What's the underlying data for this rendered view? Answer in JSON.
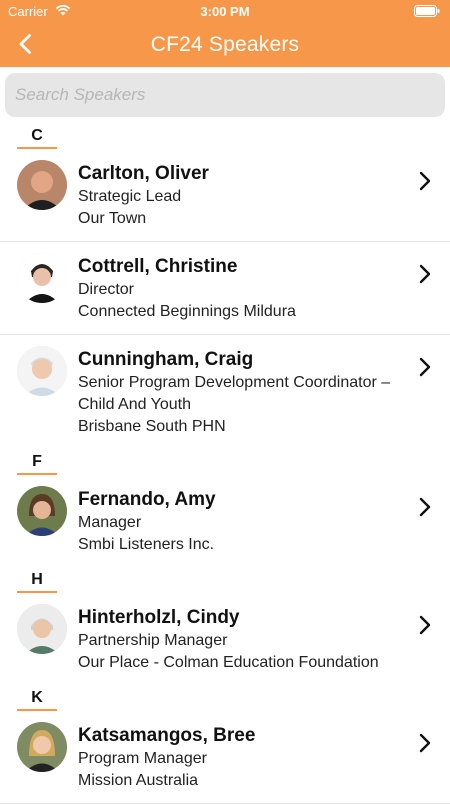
{
  "status_bar": {
    "carrier": "Carrier",
    "time": "3:00 PM",
    "wifi_icon": "wifi-icon",
    "battery_icon": "battery-icon"
  },
  "nav": {
    "title": "CF24 Speakers",
    "back_icon": "chevron-left-icon",
    "color": "#f7974a"
  },
  "search": {
    "placeholder": "Search Speakers",
    "value": ""
  },
  "sections": [
    {
      "letter": "C",
      "speakers": [
        {
          "name": "Carlton, Oliver",
          "lines": [
            "Strategic Lead",
            "Our Town"
          ]
        },
        {
          "name": "Cottrell, Christine",
          "lines": [
            "Director",
            "Connected Beginnings Mildura"
          ]
        },
        {
          "name": "Cunningham, Craig",
          "lines": [
            "Senior Program Development Coordinator –",
            "Child And Youth",
            "Brisbane South PHN"
          ]
        }
      ]
    },
    {
      "letter": "F",
      "speakers": [
        {
          "name": "Fernando, Amy",
          "lines": [
            "Manager",
            "Smbi Listeners Inc."
          ]
        }
      ]
    },
    {
      "letter": "H",
      "speakers": [
        {
          "name": "Hinterholzl, Cindy",
          "lines": [
            "Partnership Manager",
            "Our Place - Colman Education Foundation"
          ]
        }
      ]
    },
    {
      "letter": "K",
      "speakers": [
        {
          "name": "Katsamangos, Bree",
          "lines": [
            "Program Manager",
            "Mission Australia"
          ]
        }
      ]
    }
  ]
}
